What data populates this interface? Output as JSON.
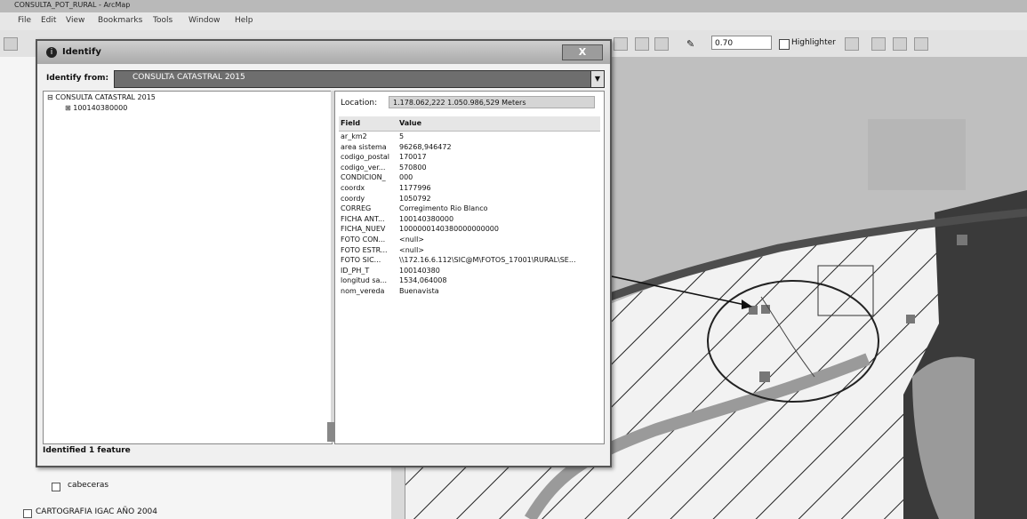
{
  "app": {
    "title": "CONSULTA_POT_RURAL - ArcMap",
    "menu": [
      "File",
      "Edit",
      "View",
      "Bookmarks",
      "Tools",
      "Window",
      "Help"
    ],
    "toolbar": {
      "line_width": "0.70",
      "highlighter_label": "Highlighter"
    }
  },
  "toc": {
    "items": [
      {
        "label": "cabeceras",
        "checked": true
      },
      {
        "label": "CARTOGRAFIA IGAC AÑO 2004",
        "checked": true
      }
    ]
  },
  "identify": {
    "title": "Identify",
    "close_label": "X",
    "identify_from_label": "Identify from:",
    "identify_from_value": "CONSULTA CATASTRAL 2015",
    "tree": {
      "layer": "CONSULTA CATASTRAL 2015",
      "feature": "100140380000"
    },
    "location_label": "Location:",
    "location_value": "1.178.062,222  1.050.986,529 Meters",
    "columns": {
      "field": "Field",
      "value": "Value"
    },
    "rows": [
      {
        "field": "ar_km2",
        "value": "5"
      },
      {
        "field": "area sistema",
        "value": "96268,946472"
      },
      {
        "field": "codigo_postal",
        "value": "170017"
      },
      {
        "field": "codigo_ver...",
        "value": "570800"
      },
      {
        "field": "CONDICION_",
        "value": "000"
      },
      {
        "field": "coordx",
        "value": "1177996"
      },
      {
        "field": "coordy",
        "value": "1050792"
      },
      {
        "field": "CORREG",
        "value": "Corregimento Rio Blanco"
      },
      {
        "field": "FICHA ANT...",
        "value": "100140380000"
      },
      {
        "field": "FICHA_NUEV",
        "value": "1000000140380000000000"
      },
      {
        "field": "FOTO CON...",
        "value": "<null>"
      },
      {
        "field": "FOTO ESTR...",
        "value": "<null>"
      },
      {
        "field": "FOTO SIC...",
        "value": "\\\\172.16.6.112\\SIC@M\\FOTOS_17001\\RURAL\\SE..."
      },
      {
        "field": "ID_PH_T",
        "value": "100140380"
      },
      {
        "field": "longitud sa...",
        "value": "1534,064008"
      },
      {
        "field": "nom_vereda",
        "value": "Buenavista"
      }
    ],
    "status": "Identified 1 feature"
  },
  "colors": {
    "map_background": "#bfbfbf",
    "zone_light": "#f2f2f2",
    "zone_dark": "#3a3a3a",
    "road": "#4d4d4d"
  }
}
